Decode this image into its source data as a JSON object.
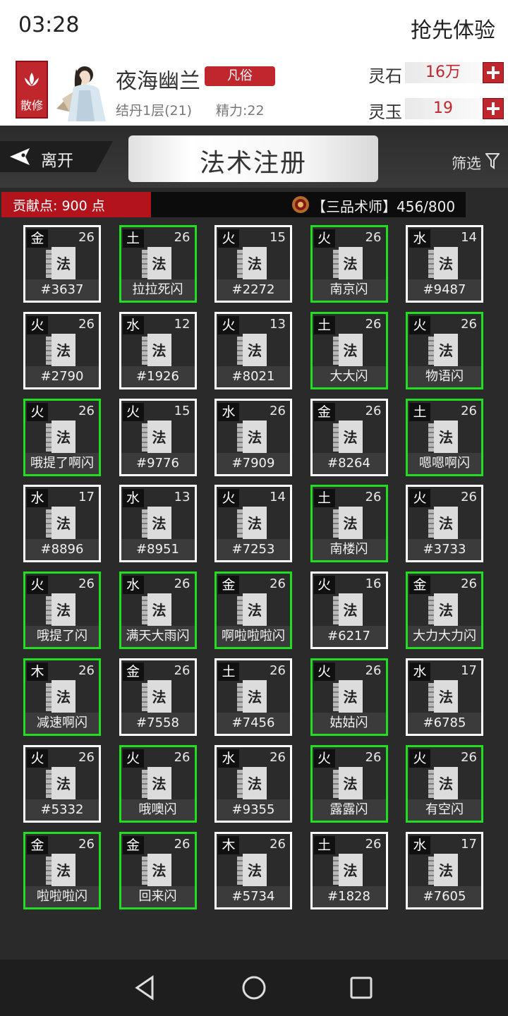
{
  "status": {
    "time": "03:28",
    "right_text": "抢先体验"
  },
  "profile": {
    "sect_badge": "散修",
    "name": "夜海幽兰",
    "rank_tag": "凡俗",
    "realm": "结丹1层(21)",
    "energy": "精力:22",
    "currencies": [
      {
        "label": "灵石",
        "value": "16万"
      },
      {
        "label": "灵玉",
        "value": "19"
      }
    ]
  },
  "nav": {
    "back_label": "离开",
    "title": "法术注册",
    "filter_label": "筛选"
  },
  "contribution": {
    "text": "贡献点: 900 点",
    "rank_text": "【三品术师】456/800"
  },
  "colors": {
    "accent_red": "#c0272d",
    "registered_border": "#22dd22",
    "unregistered_border": "#ffffff"
  },
  "book_glyph": "法",
  "spells": [
    {
      "element": "金",
      "level": "26",
      "name": "#3637",
      "registered": false
    },
    {
      "element": "土",
      "level": "26",
      "name": "拉拉死闪",
      "registered": true
    },
    {
      "element": "火",
      "level": "15",
      "name": "#2272",
      "registered": false
    },
    {
      "element": "火",
      "level": "26",
      "name": "南京闪",
      "registered": true
    },
    {
      "element": "水",
      "level": "14",
      "name": "#9487",
      "registered": false
    },
    {
      "element": "火",
      "level": "26",
      "name": "#2790",
      "registered": false
    },
    {
      "element": "水",
      "level": "12",
      "name": "#1926",
      "registered": false
    },
    {
      "element": "火",
      "level": "13",
      "name": "#8021",
      "registered": false
    },
    {
      "element": "土",
      "level": "26",
      "name": "大大闪",
      "registered": true
    },
    {
      "element": "火",
      "level": "26",
      "name": "物语闪",
      "registered": true
    },
    {
      "element": "火",
      "level": "26",
      "name": "哦提了啊闪",
      "registered": true
    },
    {
      "element": "火",
      "level": "15",
      "name": "#9776",
      "registered": false
    },
    {
      "element": "水",
      "level": "26",
      "name": "#7909",
      "registered": false
    },
    {
      "element": "金",
      "level": "26",
      "name": "#8264",
      "registered": false
    },
    {
      "element": "土",
      "level": "26",
      "name": "嗯嗯啊闪",
      "registered": true
    },
    {
      "element": "水",
      "level": "17",
      "name": "#8896",
      "registered": false
    },
    {
      "element": "水",
      "level": "13",
      "name": "#8951",
      "registered": false
    },
    {
      "element": "火",
      "level": "14",
      "name": "#7253",
      "registered": false
    },
    {
      "element": "土",
      "level": "26",
      "name": "南楼闪",
      "registered": true
    },
    {
      "element": "火",
      "level": "26",
      "name": "#3733",
      "registered": false
    },
    {
      "element": "火",
      "level": "26",
      "name": "哦提了闪",
      "registered": true
    },
    {
      "element": "水",
      "level": "26",
      "name": "满天大雨闪",
      "registered": true
    },
    {
      "element": "金",
      "level": "26",
      "name": "啊啦啦啦闪",
      "registered": true
    },
    {
      "element": "火",
      "level": "16",
      "name": "#6217",
      "registered": false
    },
    {
      "element": "金",
      "level": "26",
      "name": "大力大力闪",
      "registered": true
    },
    {
      "element": "木",
      "level": "26",
      "name": "减速啊闪",
      "registered": true
    },
    {
      "element": "金",
      "level": "26",
      "name": "#7558",
      "registered": false
    },
    {
      "element": "土",
      "level": "26",
      "name": "#7456",
      "registered": false
    },
    {
      "element": "火",
      "level": "26",
      "name": "姑姑闪",
      "registered": true
    },
    {
      "element": "水",
      "level": "17",
      "name": "#6785",
      "registered": false
    },
    {
      "element": "火",
      "level": "26",
      "name": "#5332",
      "registered": false
    },
    {
      "element": "火",
      "level": "26",
      "name": "哦噢闪",
      "registered": true
    },
    {
      "element": "水",
      "level": "26",
      "name": "#9355",
      "registered": false
    },
    {
      "element": "火",
      "level": "26",
      "name": "露露闪",
      "registered": true
    },
    {
      "element": "火",
      "level": "26",
      "name": "有空闪",
      "registered": true
    },
    {
      "element": "金",
      "level": "26",
      "name": "啦啦啦闪",
      "registered": true
    },
    {
      "element": "金",
      "level": "26",
      "name": "回来闪",
      "registered": true
    },
    {
      "element": "木",
      "level": "26",
      "name": "#5734",
      "registered": false
    },
    {
      "element": "土",
      "level": "26",
      "name": "#1828",
      "registered": false
    },
    {
      "element": "水",
      "level": "17",
      "name": "#7605",
      "registered": false
    }
  ]
}
